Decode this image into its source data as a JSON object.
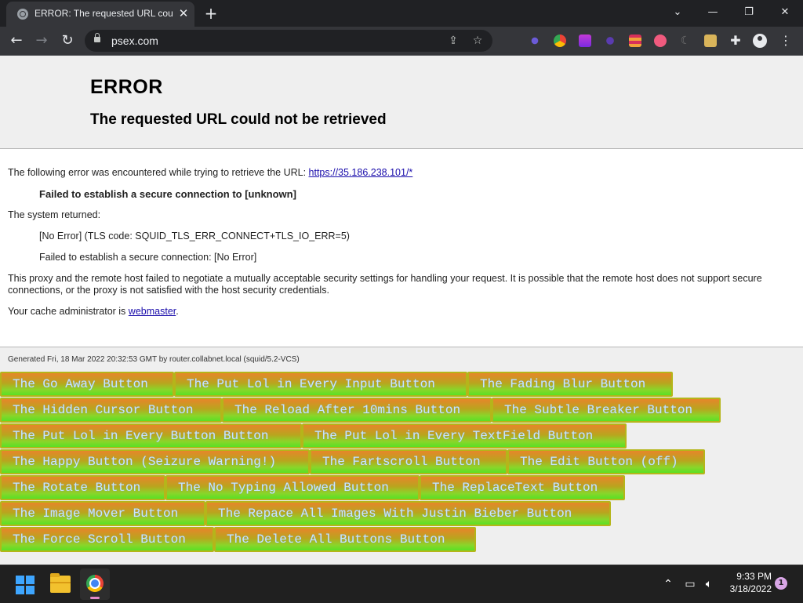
{
  "browser": {
    "tab_title": "ERROR: The requested URL could not be retrieved",
    "url": "psex.com"
  },
  "page": {
    "title": "ERROR",
    "subtitle": "The requested URL could not be retrieved",
    "intro": "The following error was encountered while trying to retrieve the URL:",
    "intro_link": "https://35.186.238.101/*",
    "failed": "Failed to establish a secure connection to [unknown]",
    "system_returned": "The system returned:",
    "error_code": "[No Error] (TLS code: SQUID_TLS_ERR_CONNECT+TLS_IO_ERR=5)",
    "error_detail": "Failed to establish a secure connection: [No Error]",
    "explanation": "This proxy and the remote host failed to negotiate a mutually acceptable security settings for handling your request. It is possible that the remote host does not support secure connections, or the proxy is not satisfied with the host security credentials.",
    "admin_prefix": "Your cache administrator is",
    "admin_link": "webmaster",
    "admin_suffix": ".",
    "generated": "Generated Fri, 18 Mar 2022 20:32:53 GMT by router.collabnet.local (squid/5.2-VCS)"
  },
  "buttons": [
    [
      "The Go Away Button",
      "The Put Lol in Every Input Button",
      "The Fading Blur Button"
    ],
    [
      "The Hidden Cursor Button",
      "The Reload After 10mins Button",
      "The Subtle Breaker Button"
    ],
    [
      "The Put Lol in Every Button Button",
      "The Put Lol in Every TextField Button"
    ],
    [
      "The Happy Button (Seizure Warning!)",
      "The Fartscroll Button",
      "The Edit Button (off)"
    ],
    [
      "The Rotate Button",
      "The No Typing Allowed Button",
      "The ReplaceText Button"
    ],
    [
      "The Image Mover Button",
      "The Repace All Images With Justin Bieber Button"
    ],
    [
      "The Force Scroll Button",
      "The Delete All Buttons Button"
    ]
  ],
  "taskbar": {
    "time": "9:33 PM",
    "date": "3/18/2022",
    "notifications": "1"
  },
  "icons": {
    "tab_favicon": "globe-icon",
    "start": "windows-start-icon",
    "files": "folder-icon",
    "app": "chrome-icon"
  }
}
